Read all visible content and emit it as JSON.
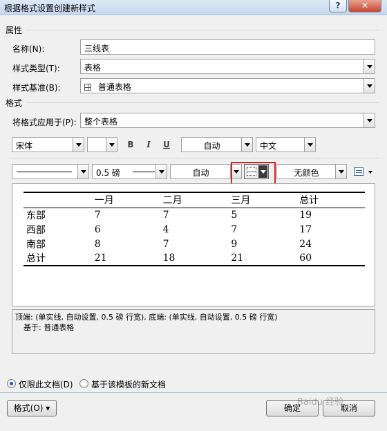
{
  "window": {
    "title": "根据格式设置创建新样式",
    "help_label": "?",
    "close_label": "✕"
  },
  "properties": {
    "section_title": "属性",
    "name_label": "名称(N):",
    "name_value": "三线表",
    "type_label": "样式类型(T):",
    "type_value": "表格",
    "base_label": "样式基准(B):",
    "base_value": "普通表格",
    "base_icon": "table-grid-icon"
  },
  "format": {
    "section_title": "格式",
    "apply_label": "将格式应用于(P):",
    "apply_value": "整个表格",
    "font_name": "宋体",
    "font_size": "",
    "bold_label": "B",
    "italic_label": "I",
    "underline_label": "U",
    "font_color": "自动",
    "script_value": "中文"
  },
  "border_toolbar": {
    "line_style": "solid-line",
    "line_weight": "0.5 磅",
    "border_color": "自动",
    "border_icon": "border-icon",
    "shading": "无颜色",
    "align_icon": "cell-align-icon"
  },
  "preview_table": {
    "headers": [
      "",
      "一月",
      "二月",
      "三月",
      "总计"
    ],
    "rows": [
      [
        "东部",
        "7",
        "7",
        "5",
        "19"
      ],
      [
        "西部",
        "6",
        "4",
        "7",
        "17"
      ],
      [
        "南部",
        "8",
        "7",
        "9",
        "24"
      ],
      [
        "总计",
        "21",
        "18",
        "21",
        "60"
      ]
    ]
  },
  "description": {
    "line1": "顶端: (单实线, 自动设置, 0.5 磅 行宽), 底端: (单实线, 自动设置, 0.5 磅 行宽)",
    "line2": "基于: 普通表格"
  },
  "options": {
    "only_this_doc": "仅限此文档(D)",
    "new_docs_template": "基于该模板的新文档",
    "selected": "only_this_doc"
  },
  "buttons": {
    "format": "格式(O) ▾",
    "ok": "确定",
    "cancel": "取消"
  },
  "watermark": "Baidu 经验",
  "colors": {
    "highlight": "#e02020",
    "radio_accent": "#1c58b5"
  }
}
